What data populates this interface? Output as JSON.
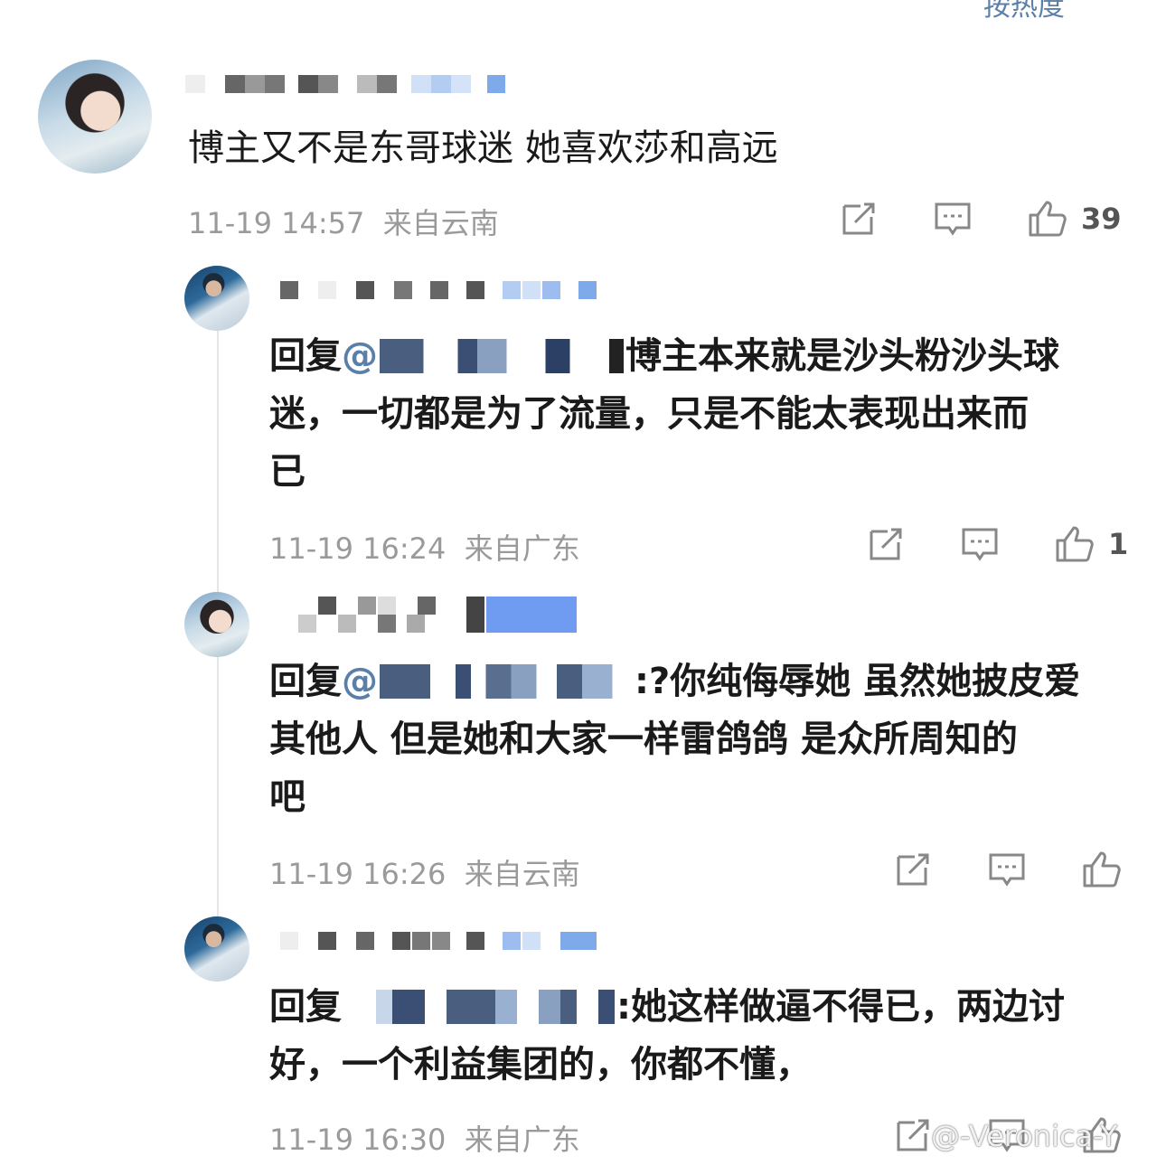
{
  "header": {
    "sort_label": "按热度"
  },
  "comments": [
    {
      "text": "博主又不是东哥球迷 她喜欢莎和高远",
      "time": "11-19 14:57",
      "location": "来自云南",
      "likes": "39"
    },
    {
      "reply_prefix": "回复",
      "mention": "@",
      "text_line1": "博主本来就是沙头粉沙头球",
      "text_line2": "迷，一切都是为了流量，只是不能太表现出来而",
      "text_line3": "已",
      "time": "11-19 16:24",
      "location": "来自广东",
      "likes": "1"
    },
    {
      "reply_prefix": "回复",
      "mention": "@",
      "text_line1": ":?你纯侮辱她 虽然她披皮爱",
      "text_line2": "其他人 但是她和大家一样雷鸽鸽 是众所周知的",
      "text_line3": "吧",
      "time": "11-19 16:26",
      "location": "来自云南",
      "likes": ""
    },
    {
      "reply_prefix": "回复",
      "text_line1": ":她这样做逼不得已，两边讨",
      "text_line2": "好，一个利益集团的，你都不懂，",
      "time": "11-19 16:30",
      "location": "来自广东",
      "likes": ""
    }
  ],
  "watermark": "@-Veronica-Y"
}
